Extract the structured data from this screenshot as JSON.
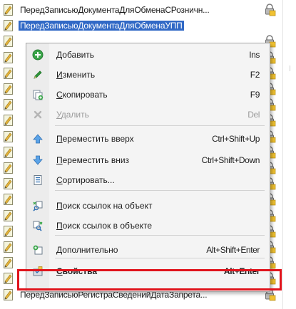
{
  "tree": {
    "rows": [
      {
        "label": "ПередЗаписьюДокументаДляОбменаСРозничн...",
        "locked": true,
        "selected": false
      },
      {
        "label": "ПередЗаписьюДокументаДляОбменаУПП",
        "locked": false,
        "selected": true
      },
      {
        "label": "",
        "locked": true,
        "selected": false
      },
      {
        "label": "",
        "locked": true,
        "selected": false
      },
      {
        "label": "",
        "locked": true,
        "selected": false
      },
      {
        "label": "",
        "locked": true,
        "selected": false
      },
      {
        "label": "",
        "locked": true,
        "selected": false
      },
      {
        "label": "",
        "locked": true,
        "selected": false
      },
      {
        "label": "",
        "locked": true,
        "selected": false
      },
      {
        "label": "",
        "locked": true,
        "selected": false
      },
      {
        "label": "",
        "locked": true,
        "selected": false
      },
      {
        "label": "",
        "locked": true,
        "selected": false
      },
      {
        "label": "",
        "locked": true,
        "selected": false
      },
      {
        "label": "",
        "locked": true,
        "selected": false
      },
      {
        "label": "",
        "locked": true,
        "selected": false
      },
      {
        "label": "",
        "locked": true,
        "selected": false
      },
      {
        "label": "",
        "locked": true,
        "selected": false
      },
      {
        "label": "",
        "locked": true,
        "selected": false
      },
      {
        "label": "ПередЗаписьюРегистраСведенийДатаЗапрета...",
        "locked": true,
        "selected": false
      }
    ]
  },
  "menu": {
    "items": [
      {
        "label": "Добавить",
        "shortcut": "Ins",
        "icon": "add-icon",
        "disabled": false,
        "bold": false
      },
      {
        "label": "Изменить",
        "shortcut": "F2",
        "icon": "pencil-icon",
        "disabled": false,
        "bold": false
      },
      {
        "label": "Скопировать",
        "shortcut": "F9",
        "icon": "copy-icon",
        "disabled": false,
        "bold": false
      },
      {
        "label": "Удалить",
        "shortcut": "Del",
        "icon": "delete-icon",
        "disabled": true,
        "bold": false
      },
      {
        "label": "Переместить вверх",
        "shortcut": "Ctrl+Shift+Up",
        "icon": "arrow-up-icon",
        "disabled": false,
        "bold": false
      },
      {
        "label": "Переместить вниз",
        "shortcut": "Ctrl+Shift+Down",
        "icon": "arrow-down-icon",
        "disabled": false,
        "bold": false
      },
      {
        "label": "Сортировать...",
        "shortcut": "",
        "icon": "sort-icon",
        "disabled": false,
        "bold": false
      },
      {
        "label": "Поиск ссылок на объект",
        "shortcut": "",
        "icon": "find-refs-to-icon",
        "disabled": false,
        "bold": false
      },
      {
        "label": "Поиск ссылок в объекте",
        "shortcut": "",
        "icon": "find-refs-in-icon",
        "disabled": false,
        "bold": false
      },
      {
        "label": "Дополнительно",
        "shortcut": "Alt+Shift+Enter",
        "icon": "more-icon",
        "disabled": false,
        "bold": false
      },
      {
        "label": "Свойства",
        "shortcut": "Alt+Enter",
        "icon": "properties-icon",
        "disabled": false,
        "bold": true
      }
    ]
  },
  "colors": {
    "selection": "#3169c6",
    "highlight_frame": "#e0141c",
    "menu_bg": "#f4f4f4"
  }
}
